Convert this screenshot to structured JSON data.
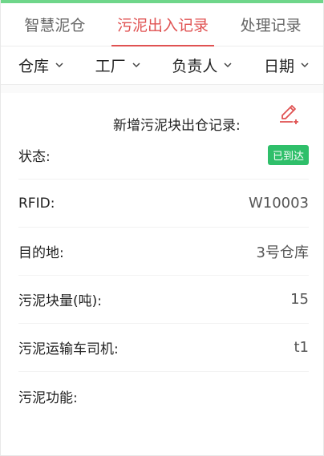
{
  "tabs": [
    {
      "label": "智慧泥仓",
      "active": false
    },
    {
      "label": "污泥出入记录",
      "active": true
    },
    {
      "label": "处理记录",
      "active": false
    }
  ],
  "filters": [
    {
      "label": "仓库"
    },
    {
      "label": "工厂"
    },
    {
      "label": "负责人"
    },
    {
      "label": "日期"
    }
  ],
  "record": {
    "title": "新增污泥块出仓记录:",
    "edit_icon": "edit-plus-icon",
    "fields": {
      "status": {
        "label": "状态:",
        "value": "已到达"
      },
      "rfid": {
        "label": "RFID:",
        "value": "W10003"
      },
      "destination": {
        "label": "目的地:",
        "value": "3号仓库"
      },
      "quantity": {
        "label": "污泥块量(吨):",
        "value": "15"
      },
      "driver": {
        "label": "污泥运输车司机:",
        "value": "t1"
      },
      "function": {
        "label": "污泥功能:",
        "value": ""
      }
    }
  },
  "colors": {
    "accent": "#e05252",
    "status_badge": "#2fbf6a",
    "top_bar": "#6fd68a"
  }
}
